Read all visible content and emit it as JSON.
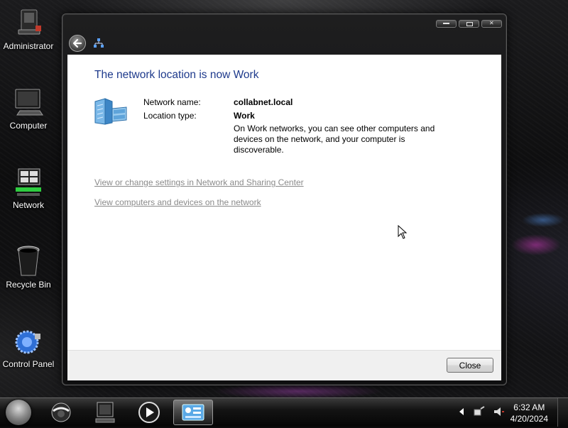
{
  "desktop": {
    "icons": [
      {
        "label": "Administrator",
        "icon": "user-folder-icon"
      },
      {
        "label": "Computer",
        "icon": "computer-icon"
      },
      {
        "label": "Network",
        "icon": "network-icon"
      },
      {
        "label": "Recycle Bin",
        "icon": "recycle-bin-icon"
      },
      {
        "label": "Control Panel",
        "icon": "control-panel-icon"
      }
    ]
  },
  "dialog": {
    "heading": "The network location is now Work",
    "fields": {
      "network_name_label": "Network name:",
      "network_name_value": "collabnet.local",
      "location_type_label": "Location type:",
      "location_type_value": "Work"
    },
    "description": "On Work networks, you can see other computers and devices on the network, and your computer is discoverable.",
    "links": {
      "sharing_center": "View or change settings in Network and Sharing Center",
      "view_computers": "View computers and devices on the network"
    },
    "close_label": "Close"
  },
  "taskbar": {
    "time": "6:32 AM",
    "date": "4/20/2024",
    "pinned": [
      "internet-browser-icon",
      "computer-icon",
      "media-player-icon",
      "control-panel-icon"
    ]
  },
  "colors": {
    "heading": "#1e3a8c",
    "link": "#8a8a8a"
  }
}
